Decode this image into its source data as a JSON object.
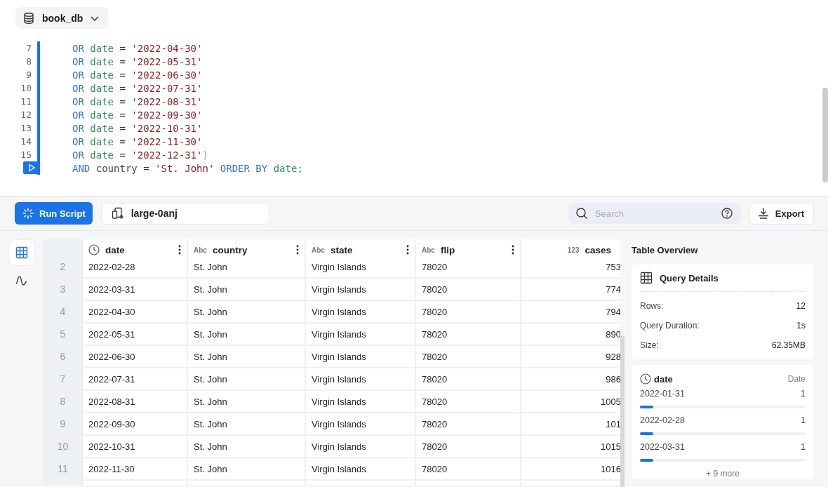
{
  "database": {
    "name": "book_db"
  },
  "editor": {
    "lines": [
      {
        "number": "7",
        "tokens": [
          {
            "kind": "kw",
            "text": "OR"
          },
          {
            "kind": "col",
            "text": "date"
          },
          {
            "kind": "op",
            "text": "="
          },
          {
            "kind": "str",
            "text": "'2022-04-30'"
          }
        ]
      },
      {
        "number": "8",
        "tokens": [
          {
            "kind": "kw",
            "text": "OR"
          },
          {
            "kind": "col",
            "text": "date"
          },
          {
            "kind": "op",
            "text": "="
          },
          {
            "kind": "str",
            "text": "'2022-05-31'"
          }
        ]
      },
      {
        "number": "9",
        "tokens": [
          {
            "kind": "kw",
            "text": "OR"
          },
          {
            "kind": "col",
            "text": "date"
          },
          {
            "kind": "op",
            "text": "="
          },
          {
            "kind": "str",
            "text": "'2022-06-30'"
          }
        ]
      },
      {
        "number": "10",
        "tokens": [
          {
            "kind": "kw",
            "text": "OR"
          },
          {
            "kind": "col",
            "text": "date"
          },
          {
            "kind": "op",
            "text": "="
          },
          {
            "kind": "str",
            "text": "'2022-07-31'"
          }
        ]
      },
      {
        "number": "11",
        "tokens": [
          {
            "kind": "kw",
            "text": "OR"
          },
          {
            "kind": "col",
            "text": "date"
          },
          {
            "kind": "op",
            "text": "="
          },
          {
            "kind": "str",
            "text": "'2022-08-31'"
          }
        ]
      },
      {
        "number": "12",
        "tokens": [
          {
            "kind": "kw",
            "text": "OR"
          },
          {
            "kind": "col",
            "text": "date"
          },
          {
            "kind": "op",
            "text": "="
          },
          {
            "kind": "str",
            "text": "'2022-09-30'"
          }
        ]
      },
      {
        "number": "13",
        "tokens": [
          {
            "kind": "kw",
            "text": "OR"
          },
          {
            "kind": "col",
            "text": "date"
          },
          {
            "kind": "op",
            "text": "="
          },
          {
            "kind": "str",
            "text": "'2022-10-31'"
          }
        ]
      },
      {
        "number": "14",
        "tokens": [
          {
            "kind": "kw",
            "text": "OR"
          },
          {
            "kind": "col",
            "text": "date"
          },
          {
            "kind": "op",
            "text": "="
          },
          {
            "kind": "str",
            "text": "'2022-11-30'"
          }
        ]
      },
      {
        "number": "15",
        "tokens": [
          {
            "kind": "kw",
            "text": "OR"
          },
          {
            "kind": "col",
            "text": "date"
          },
          {
            "kind": "op",
            "text": "="
          },
          {
            "kind": "str",
            "text": "'2022-12-31'"
          },
          {
            "kind": "paren",
            "text": ")"
          }
        ]
      },
      {
        "tokens": [
          {
            "kind": "kw",
            "text": "AND"
          },
          {
            "kind": "id",
            "text": "country"
          },
          {
            "kind": "op",
            "text": "="
          },
          {
            "kind": "str",
            "text": "'St. John'"
          },
          {
            "kind": "kw",
            "text": "ORDER BY"
          },
          {
            "kind": "col",
            "text": "date;"
          }
        ]
      }
    ]
  },
  "toolbar": {
    "run_label": "Run Script",
    "cluster": "large-0anj",
    "search": {
      "placeholder": "Search"
    },
    "export_label": "Export"
  },
  "rail": [
    {
      "kind": "table",
      "selected": true
    },
    {
      "kind": "chart",
      "selected": false
    }
  ],
  "table": {
    "columns": [
      {
        "kind": "date",
        "label": "date"
      },
      {
        "kind": "text",
        "type_label": "Abc",
        "label": "country"
      },
      {
        "kind": "text",
        "type_label": "Abc",
        "label": "state"
      },
      {
        "kind": "text",
        "type_label": "Abc",
        "label": "flip"
      },
      {
        "kind": "number",
        "type_label": "123",
        "label": "cases"
      }
    ],
    "rows": [
      {
        "index": "2",
        "cells": [
          "2022-02-28",
          "St. John",
          "Virgin Islands",
          "78020",
          "753"
        ]
      },
      {
        "index": "3",
        "cells": [
          "2022-03-31",
          "St. John",
          "Virgin Islands",
          "78020",
          "774"
        ]
      },
      {
        "index": "4",
        "cells": [
          "2022-04-30",
          "St. John",
          "Virgin Islands",
          "78020",
          "794"
        ]
      },
      {
        "index": "5",
        "cells": [
          "2022-05-31",
          "St. John",
          "Virgin Islands",
          "78020",
          "890"
        ]
      },
      {
        "index": "6",
        "cells": [
          "2022-06-30",
          "St. John",
          "Virgin Islands",
          "78020",
          "928"
        ]
      },
      {
        "index": "7",
        "cells": [
          "2022-07-31",
          "St. John",
          "Virgin Islands",
          "78020",
          "986"
        ]
      },
      {
        "index": "8",
        "cells": [
          "2022-08-31",
          "St. John",
          "Virgin Islands",
          "78020",
          "1005"
        ]
      },
      {
        "index": "9",
        "cells": [
          "2022-09-30",
          "St. John",
          "Virgin Islands",
          "78020",
          "101"
        ]
      },
      {
        "index": "10",
        "cells": [
          "2022-10-31",
          "St. John",
          "Virgin Islands",
          "78020",
          "1015"
        ]
      },
      {
        "index": "11",
        "cells": [
          "2022-11-30",
          "St. John",
          "Virgin Islands",
          "78020",
          "1016"
        ]
      }
    ]
  },
  "overview": {
    "title": "Table Overview",
    "details": {
      "title": "Query Details",
      "items": [
        {
          "label": "Rows:",
          "value": "12"
        },
        {
          "label": "Query Duration:",
          "value": "1s"
        },
        {
          "label": "Size:",
          "value": "62.35MB"
        }
      ]
    },
    "column": {
      "name": "date",
      "type": "Date",
      "values": [
        {
          "label": "2022-01-31",
          "count": "1",
          "level": 0.08
        },
        {
          "label": "2022-02-28",
          "count": "1",
          "level": 0.08
        },
        {
          "label": "2022-03-31",
          "count": "1",
          "level": 0.08
        }
      ],
      "more": "+ 9 more"
    }
  }
}
